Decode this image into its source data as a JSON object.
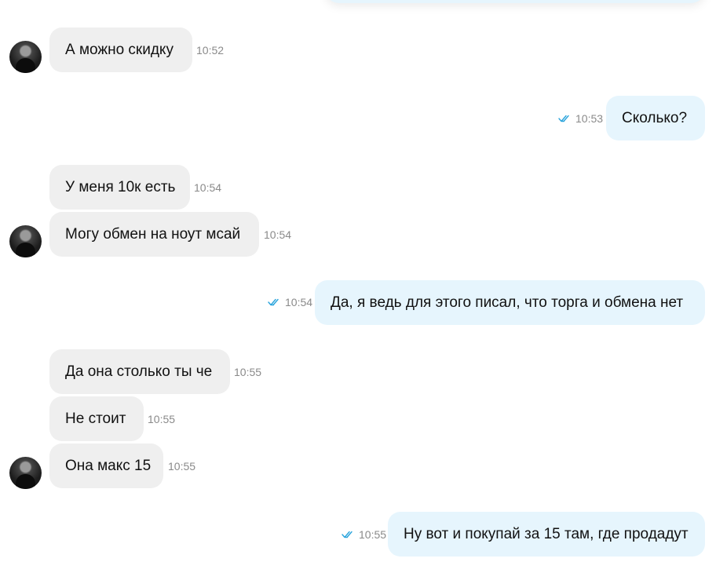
{
  "messages": [
    {
      "text": "А можно скидку",
      "time": "10:52"
    },
    {
      "text": "Сколько?",
      "time": "10:53"
    },
    {
      "text": "У меня 10к есть",
      "time": "10:54"
    },
    {
      "text": "Могу обмен на ноут мсай",
      "time": "10:54"
    },
    {
      "text": "Да, я ведь для этого писал, что торга и обмена нет",
      "time": "10:54"
    },
    {
      "text": "Да она столько ты че",
      "time": "10:55"
    },
    {
      "text": "Не стоит",
      "time": "10:55"
    },
    {
      "text": "Она макс 15",
      "time": "10:55"
    },
    {
      "text": "Ну вот и покупай за 15 там, где продадут",
      "time": "10:55"
    }
  ],
  "colors": {
    "incoming_bubble": "#efefef",
    "outgoing_bubble": "#e6f5fd",
    "read_check": "#2aa4dc",
    "timestamp": "#8a8a8a"
  },
  "icons": {
    "read_receipt": "double-check-icon",
    "avatar": "user-avatar"
  }
}
